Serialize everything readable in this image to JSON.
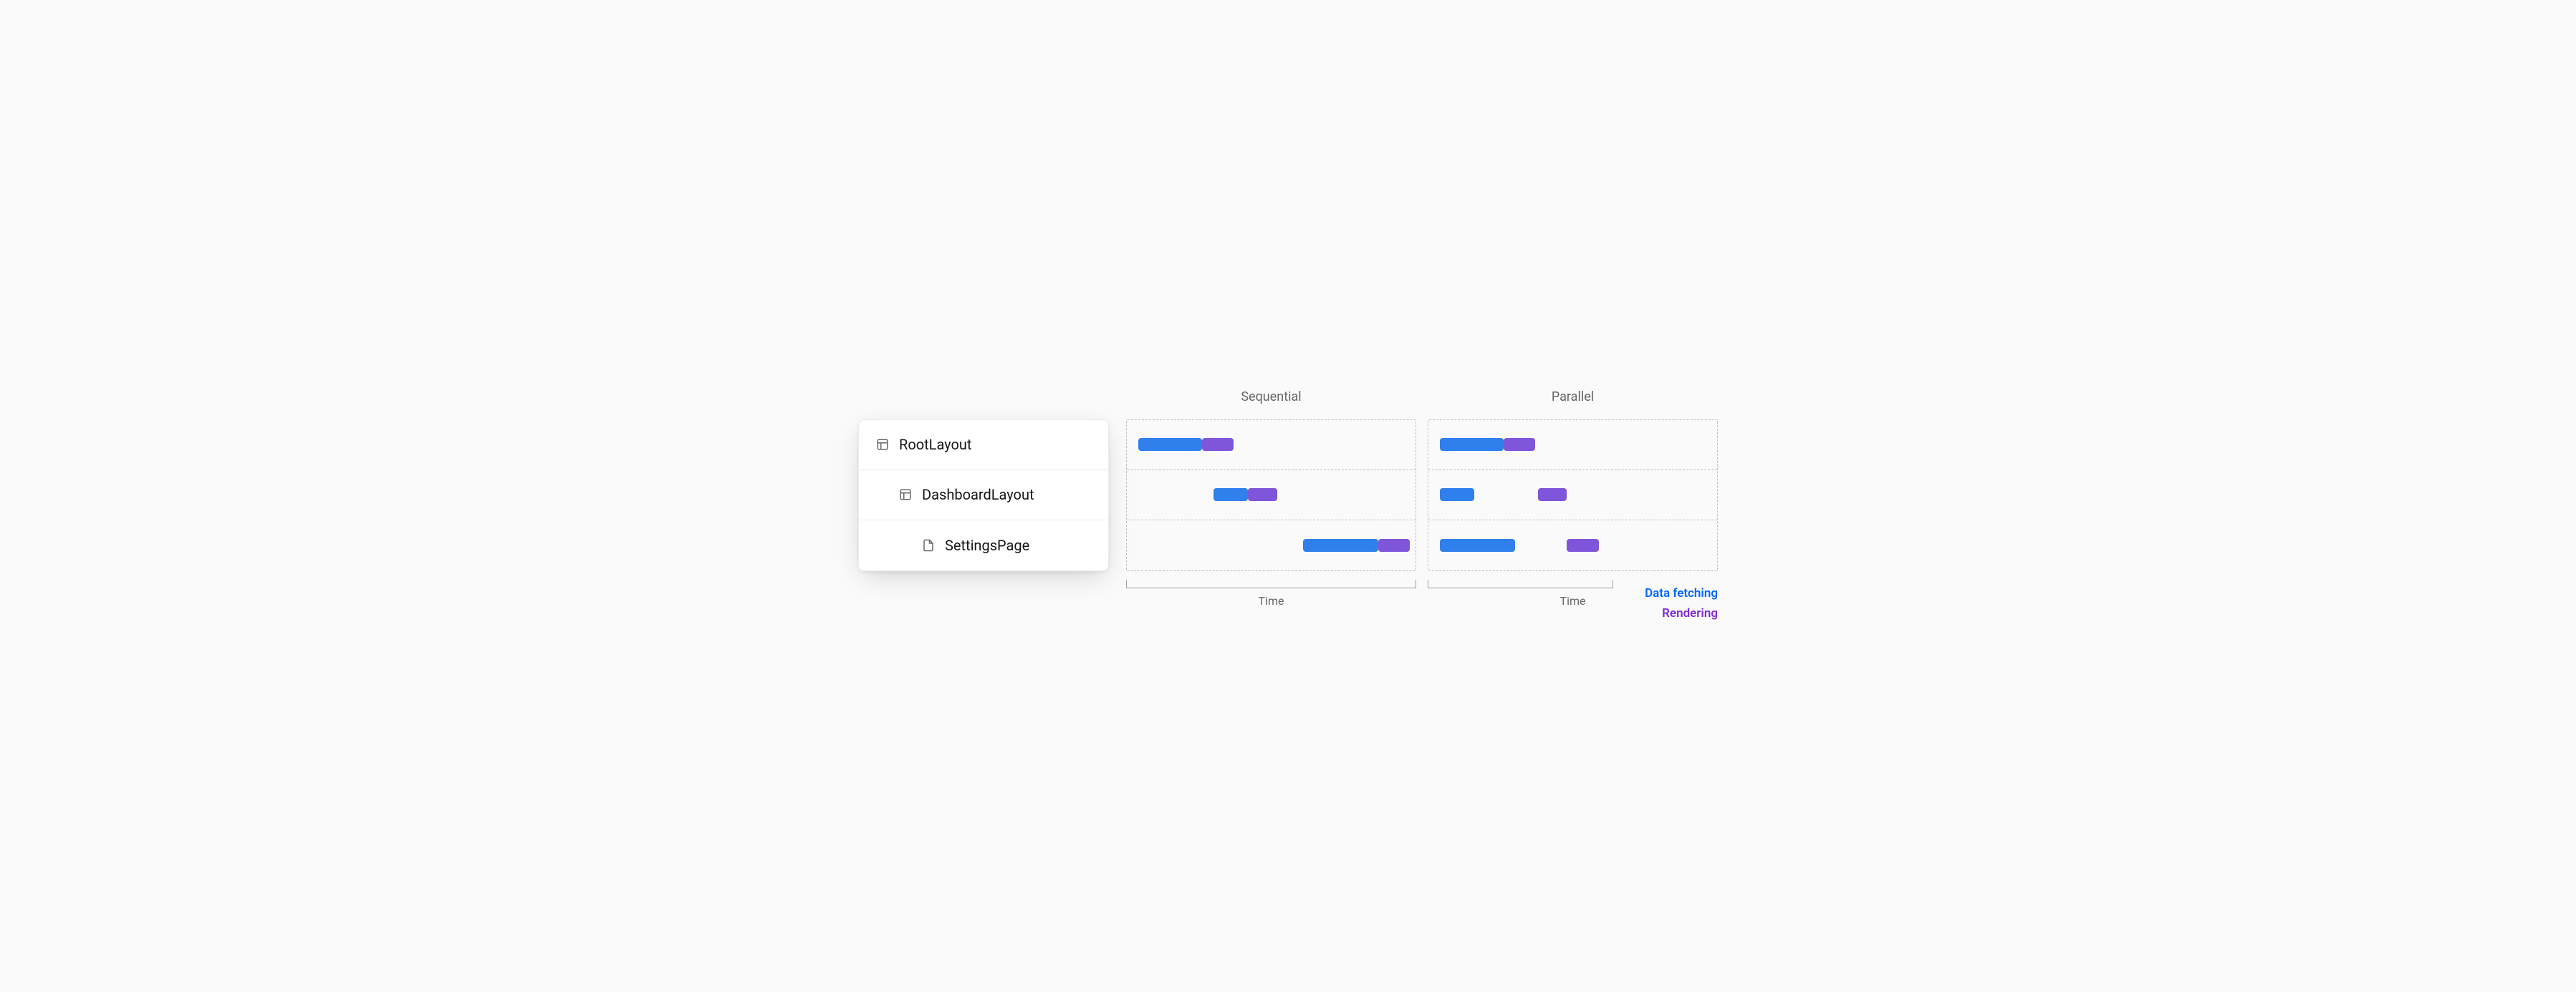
{
  "tree": {
    "items": [
      {
        "label": "RootLayout",
        "icon": "layout",
        "indent": 0
      },
      {
        "label": "DashboardLayout",
        "icon": "layout",
        "indent": 1
      },
      {
        "label": "SettingsPage",
        "icon": "file",
        "indent": 2
      }
    ]
  },
  "chart_data": [
    {
      "type": "bar",
      "title": "Sequential",
      "xlabel": "Time",
      "ylabel": "",
      "categories": [
        "RootLayout",
        "DashboardLayout",
        "SettingsPage"
      ],
      "xlim": [
        0,
        100
      ],
      "series": [
        {
          "name": "Data fetching",
          "color": "#2f80ed",
          "ranges": [
            [
              4,
              26
            ],
            [
              30,
              42
            ],
            [
              61,
              87
            ]
          ]
        },
        {
          "name": "Rendering",
          "color": "#7f56d9",
          "ranges": [
            [
              26,
              37
            ],
            [
              42,
              52
            ],
            [
              87,
              98
            ]
          ]
        }
      ],
      "time_bracket_pct": 100
    },
    {
      "type": "bar",
      "title": "Parallel",
      "xlabel": "Time",
      "ylabel": "",
      "categories": [
        "RootLayout",
        "DashboardLayout",
        "SettingsPage"
      ],
      "xlim": [
        0,
        100
      ],
      "series": [
        {
          "name": "Data fetching",
          "color": "#2f80ed",
          "ranges": [
            [
              4,
              26
            ],
            [
              4,
              16
            ],
            [
              4,
              30
            ]
          ]
        },
        {
          "name": "Rendering",
          "color": "#7f56d9",
          "ranges": [
            [
              26,
              37
            ],
            [
              38,
              48
            ],
            [
              48,
              59
            ]
          ]
        }
      ],
      "time_bracket_pct": 64
    }
  ],
  "legend": {
    "fetch": "Data fetching",
    "render": "Rendering"
  },
  "colors": {
    "fetch": "#2f80ed",
    "render": "#7f56d9",
    "legend_fetch": "#0066ff",
    "legend_render": "#7f2bd6"
  }
}
